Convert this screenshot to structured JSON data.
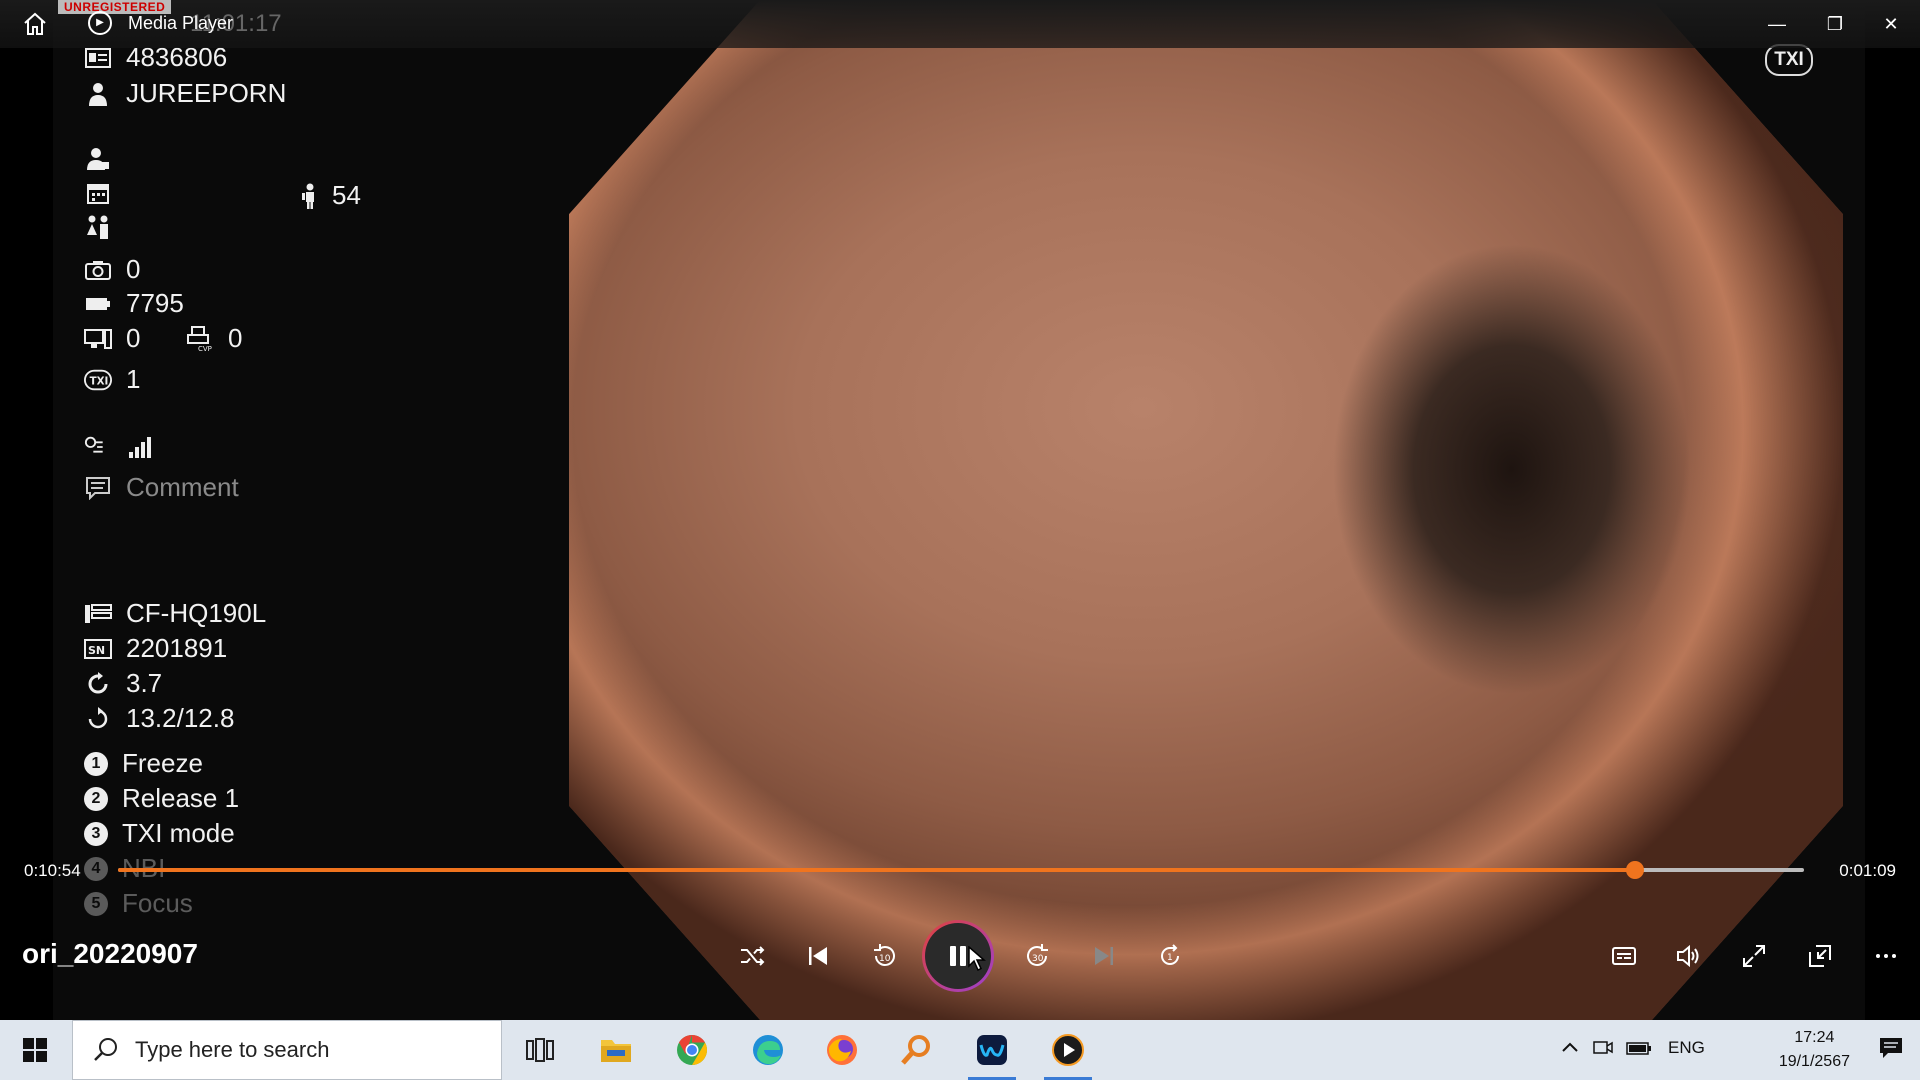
{
  "window": {
    "app_title": "Media Player",
    "watermark": "UNREGISTERED",
    "ghost_time": "11:01:17",
    "buttons": {
      "minimize": "—",
      "restore": "❐",
      "close": "✕"
    }
  },
  "overlay": {
    "patient_id": "4836806",
    "patient_name": "JUREEPORN",
    "age": "54",
    "camera_count": "0",
    "battery_value": "7795",
    "monitor_value": "0",
    "cvp_value": "0",
    "txi_value": "1",
    "comment": "Comment",
    "scope_model": "CF-HQ190L",
    "serial_no": "2201891",
    "rotation_value": "3.7",
    "ratio_value": "13.2/12.8",
    "buttons": [
      {
        "num": "1",
        "label": "Freeze"
      },
      {
        "num": "2",
        "label": "Release 1"
      },
      {
        "num": "3",
        "label": "TXI mode"
      },
      {
        "num": "4",
        "label": "NBI"
      },
      {
        "num": "5",
        "label": "Focus"
      }
    ],
    "txi_badge": "TXI"
  },
  "player": {
    "elapsed": "0:10:54",
    "remaining": "0:01:09",
    "progress": 0.9,
    "media_title": "ori_20220907"
  },
  "taskbar": {
    "search_placeholder": "Type here to search",
    "language": "ENG",
    "time": "17:24",
    "date": "19/1/2567"
  }
}
